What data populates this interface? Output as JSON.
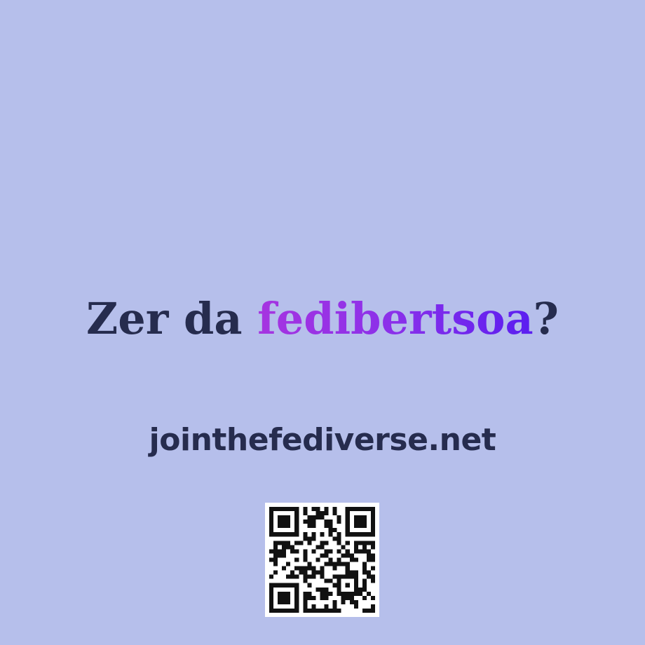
{
  "headline": {
    "prefix": "Zer da ",
    "highlight": "fedibertsoa",
    "suffix": "?"
  },
  "url": "jointhefediverse.net",
  "colors": {
    "background": "#b6bfeb",
    "text": "#262c4e",
    "gradient_start": "#a634e0",
    "gradient_end": "#5a1ef0"
  },
  "qr": {
    "icon": "qr-code-icon"
  }
}
